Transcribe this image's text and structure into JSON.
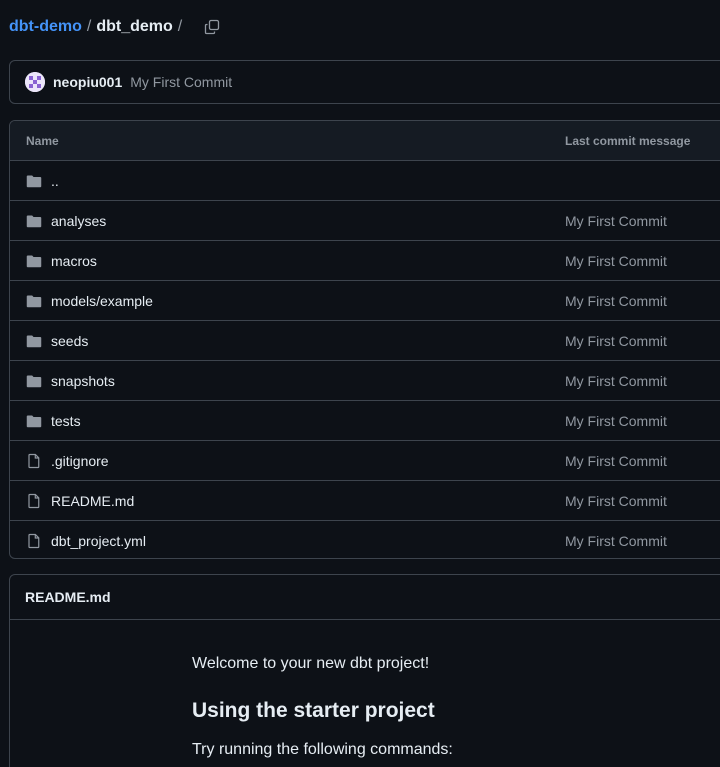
{
  "breadcrumb": {
    "repo": "dbt-demo",
    "separator": "/",
    "folder": "dbt_demo",
    "trailing": "/"
  },
  "latest_commit": {
    "user": "neopiu001",
    "message": "My First Commit"
  },
  "file_table": {
    "headers": {
      "name": "Name",
      "last_commit": "Last commit message"
    },
    "parent": "..",
    "rows": [
      {
        "type": "folder",
        "name": "analyses",
        "message": "My First Commit"
      },
      {
        "type": "folder",
        "name": "macros",
        "message": "My First Commit"
      },
      {
        "type": "folder",
        "name": "models/example",
        "message": "My First Commit"
      },
      {
        "type": "folder",
        "name": "seeds",
        "message": "My First Commit"
      },
      {
        "type": "folder",
        "name": "snapshots",
        "message": "My First Commit"
      },
      {
        "type": "folder",
        "name": "tests",
        "message": "My First Commit"
      },
      {
        "type": "file",
        "name": ".gitignore",
        "message": "My First Commit"
      },
      {
        "type": "file",
        "name": "README.md",
        "message": "My First Commit"
      },
      {
        "type": "file",
        "name": "dbt_project.yml",
        "message": "My First Commit"
      }
    ]
  },
  "readme": {
    "title": "README.md",
    "intro": "Welcome to your new dbt project!",
    "heading": "Using the starter project",
    "paragraph": "Try running the following commands:"
  },
  "colors": {
    "background": "#0d1117",
    "link": "#4493f8",
    "muted": "#9198a1",
    "border": "#3d444d"
  },
  "icons": {
    "folder": "folder-icon",
    "file": "file-icon",
    "copy": "copy-icon"
  }
}
